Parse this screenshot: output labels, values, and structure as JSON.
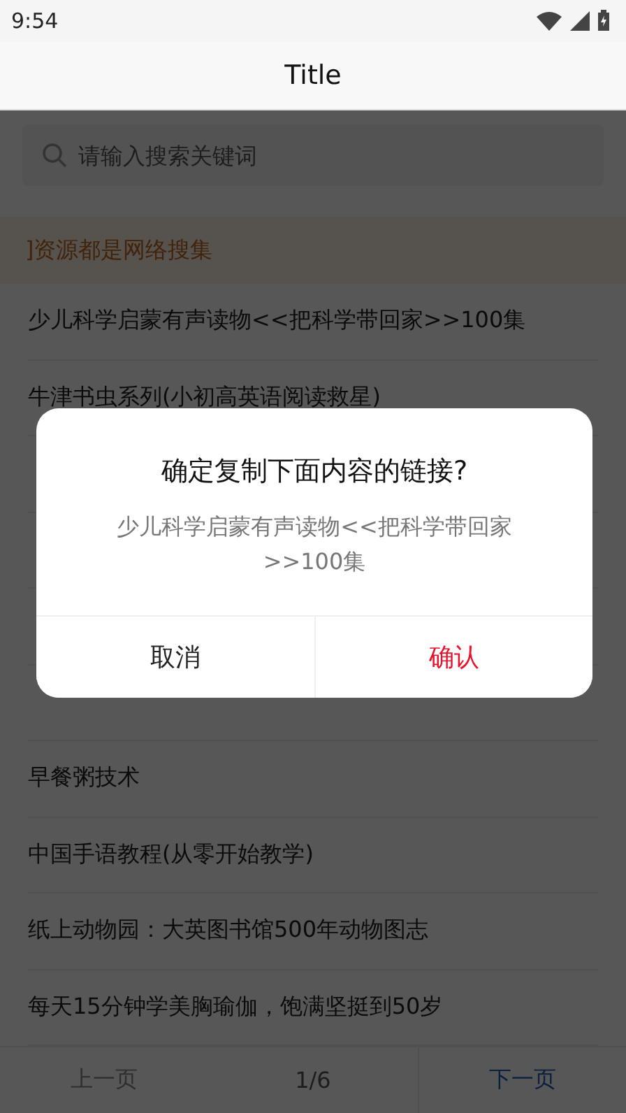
{
  "status_bar": {
    "time": "9:54"
  },
  "title": "Title",
  "search": {
    "placeholder": "请输入搜索关键词"
  },
  "notice": "]资源都是网络搜集",
  "items": [
    {
      "text": "少儿科学启蒙有声读物<<把科学带回家>>100集"
    },
    {
      "text": "牛津书虫系列(小初高英语阅读救星)"
    },
    {
      "text": "早餐粥技术"
    },
    {
      "text": "中国手语教程(从零开始教学)"
    },
    {
      "text": "纸上动物园：大英图书馆500年动物图志"
    },
    {
      "text": "每天15分钟学美胸瑜伽，饱满坚挺到50岁"
    }
  ],
  "pager": {
    "prev": {
      "label": "上一页",
      "disabled": true
    },
    "page": "1/6",
    "next": {
      "label": "下一页",
      "disabled": false
    }
  },
  "dialog": {
    "title": "确定复制下面内容的链接?",
    "message": "少儿科学启蒙有声读物<<把科学带回家>>100集",
    "buttons": [
      {
        "label": "取消",
        "kind": "cancel"
      },
      {
        "label": "确认",
        "kind": "confirm"
      }
    ]
  }
}
